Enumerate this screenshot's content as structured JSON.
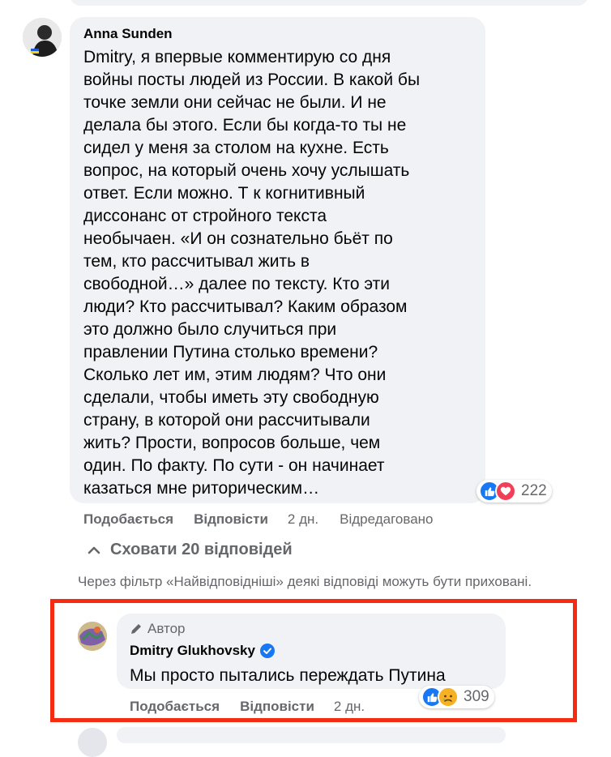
{
  "colors": {
    "bubble_bg": "#f0f2f5",
    "secondary_text": "#65676b",
    "highlight_border": "#f42c12",
    "like_blue": "#1877f2",
    "love_red": "#f33e58",
    "sad_yellow": "#f7b125"
  },
  "anna_comment": {
    "author": "Anna Sunden",
    "text": "Dmitry, я впервые комментирую со дня\nвойны посты людей из России. В какой бы\nточке земли они сейчас не были. И не\nделала бы этого. Если бы когда-то ты не\nсидел у меня за столом на кухне. Есть\nвопрос, на который очень хочу услышать\nответ. Если можно. Т к когнитивный\nдиссонанс от стройного текста\nнеобычаен. «И он сознательно бьёт по\nтем, кто рассчитывал жить в\nсвободной…» далее по тексту. Кто эти\nлюди? Кто рассчитывал? Каким образом\nэто должно было случиться при\nправлении Путина столько времени?\nСколько лет им, этим людям? Что они\nсделали, чтобы иметь эту свободную\nстрану, в которой они рассчитывали\nжить? Прости, вопросов больше, чем\nодин. По факту. По сути - он начинает\nказаться мне риторическим…",
    "reactions": {
      "icons": [
        "like-icon",
        "love-icon"
      ],
      "count": "222"
    },
    "actions": {
      "like": "Подобається",
      "reply": "Відповісти",
      "time": "2 дн.",
      "edited": "Відредаговано"
    }
  },
  "replies_toggle": {
    "label": "Сховати 20 відповідей",
    "icon": "chevron-up-icon"
  },
  "filter_note": "Через фільтр «Найвідповідніші» деякі відповіді можуть бути приховані.",
  "dmitry_reply": {
    "author_tag": "Автор",
    "author": "Dmitry Glukhovsky",
    "verified": true,
    "text": "Мы просто пытались переждать Путина",
    "reactions": {
      "icons": [
        "like-icon",
        "sad-icon"
      ],
      "count": "309"
    },
    "actions": {
      "like": "Подобається",
      "reply": "Відповісти",
      "time": "2 дн."
    }
  }
}
